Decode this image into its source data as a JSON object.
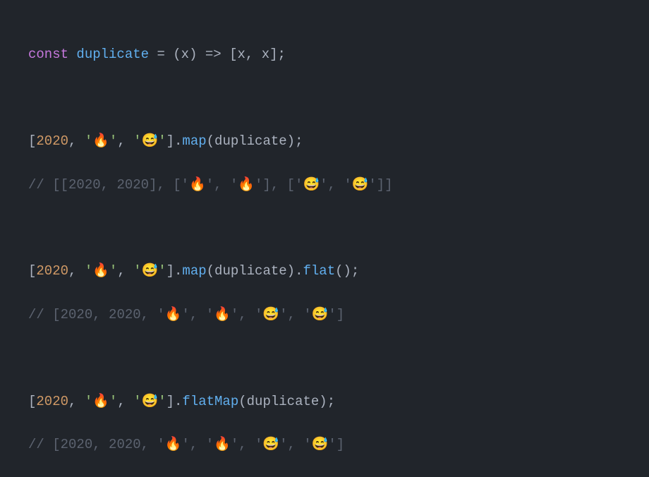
{
  "tokens": {
    "const": "const",
    "duplicate": "duplicate",
    "equals": " = ",
    "lparen": "(",
    "rparen": ")",
    "x": "x",
    "arrow": " => ",
    "lbracket": "[",
    "rbracket": "]",
    "comma": ", ",
    "semicolon": ";",
    "dot": ".",
    "map": "map",
    "flat": "flat",
    "flatMap": "flatMap",
    "num2020": "2020",
    "quote": "'",
    "fire": "🔥",
    "sweat": "😅",
    "commentPrefix": "// "
  },
  "comments": {
    "c1_open": "[[",
    "c1_inner": "2020, 2020",
    "c1_mid1": "], ['",
    "c1_mid2": "', '",
    "c1_mid3": "'], ['",
    "c1_close": "']]",
    "c2_open": "[",
    "c2_nums": "2020, 2020, '",
    "c2_sep": "', '",
    "c2_close": "']"
  }
}
